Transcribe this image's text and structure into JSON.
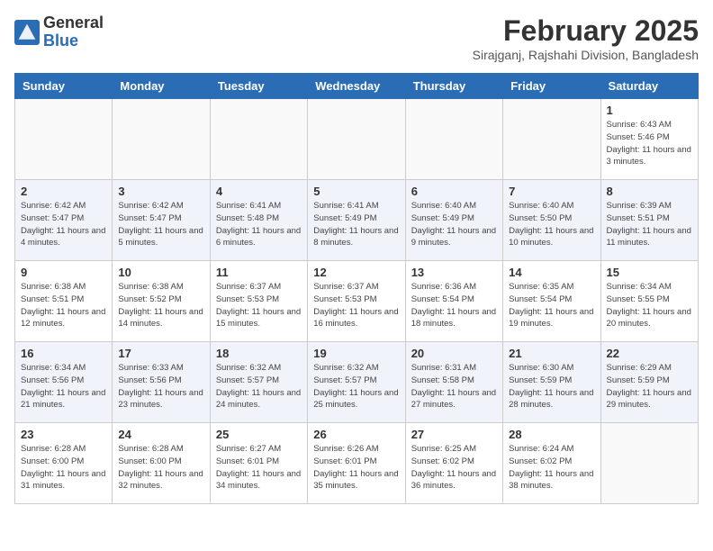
{
  "header": {
    "logo_general": "General",
    "logo_blue": "Blue",
    "month_year": "February 2025",
    "location": "Sirajganj, Rajshahi Division, Bangladesh"
  },
  "days_of_week": [
    "Sunday",
    "Monday",
    "Tuesday",
    "Wednesday",
    "Thursday",
    "Friday",
    "Saturday"
  ],
  "weeks": [
    [
      {
        "day": "",
        "info": ""
      },
      {
        "day": "",
        "info": ""
      },
      {
        "day": "",
        "info": ""
      },
      {
        "day": "",
        "info": ""
      },
      {
        "day": "",
        "info": ""
      },
      {
        "day": "",
        "info": ""
      },
      {
        "day": "1",
        "info": "Sunrise: 6:43 AM\nSunset: 5:46 PM\nDaylight: 11 hours and 3 minutes."
      }
    ],
    [
      {
        "day": "2",
        "info": "Sunrise: 6:42 AM\nSunset: 5:47 PM\nDaylight: 11 hours and 4 minutes."
      },
      {
        "day": "3",
        "info": "Sunrise: 6:42 AM\nSunset: 5:47 PM\nDaylight: 11 hours and 5 minutes."
      },
      {
        "day": "4",
        "info": "Sunrise: 6:41 AM\nSunset: 5:48 PM\nDaylight: 11 hours and 6 minutes."
      },
      {
        "day": "5",
        "info": "Sunrise: 6:41 AM\nSunset: 5:49 PM\nDaylight: 11 hours and 8 minutes."
      },
      {
        "day": "6",
        "info": "Sunrise: 6:40 AM\nSunset: 5:49 PM\nDaylight: 11 hours and 9 minutes."
      },
      {
        "day": "7",
        "info": "Sunrise: 6:40 AM\nSunset: 5:50 PM\nDaylight: 11 hours and 10 minutes."
      },
      {
        "day": "8",
        "info": "Sunrise: 6:39 AM\nSunset: 5:51 PM\nDaylight: 11 hours and 11 minutes."
      }
    ],
    [
      {
        "day": "9",
        "info": "Sunrise: 6:38 AM\nSunset: 5:51 PM\nDaylight: 11 hours and 12 minutes."
      },
      {
        "day": "10",
        "info": "Sunrise: 6:38 AM\nSunset: 5:52 PM\nDaylight: 11 hours and 14 minutes."
      },
      {
        "day": "11",
        "info": "Sunrise: 6:37 AM\nSunset: 5:53 PM\nDaylight: 11 hours and 15 minutes."
      },
      {
        "day": "12",
        "info": "Sunrise: 6:37 AM\nSunset: 5:53 PM\nDaylight: 11 hours and 16 minutes."
      },
      {
        "day": "13",
        "info": "Sunrise: 6:36 AM\nSunset: 5:54 PM\nDaylight: 11 hours and 18 minutes."
      },
      {
        "day": "14",
        "info": "Sunrise: 6:35 AM\nSunset: 5:54 PM\nDaylight: 11 hours and 19 minutes."
      },
      {
        "day": "15",
        "info": "Sunrise: 6:34 AM\nSunset: 5:55 PM\nDaylight: 11 hours and 20 minutes."
      }
    ],
    [
      {
        "day": "16",
        "info": "Sunrise: 6:34 AM\nSunset: 5:56 PM\nDaylight: 11 hours and 21 minutes."
      },
      {
        "day": "17",
        "info": "Sunrise: 6:33 AM\nSunset: 5:56 PM\nDaylight: 11 hours and 23 minutes."
      },
      {
        "day": "18",
        "info": "Sunrise: 6:32 AM\nSunset: 5:57 PM\nDaylight: 11 hours and 24 minutes."
      },
      {
        "day": "19",
        "info": "Sunrise: 6:32 AM\nSunset: 5:57 PM\nDaylight: 11 hours and 25 minutes."
      },
      {
        "day": "20",
        "info": "Sunrise: 6:31 AM\nSunset: 5:58 PM\nDaylight: 11 hours and 27 minutes."
      },
      {
        "day": "21",
        "info": "Sunrise: 6:30 AM\nSunset: 5:59 PM\nDaylight: 11 hours and 28 minutes."
      },
      {
        "day": "22",
        "info": "Sunrise: 6:29 AM\nSunset: 5:59 PM\nDaylight: 11 hours and 29 minutes."
      }
    ],
    [
      {
        "day": "23",
        "info": "Sunrise: 6:28 AM\nSunset: 6:00 PM\nDaylight: 11 hours and 31 minutes."
      },
      {
        "day": "24",
        "info": "Sunrise: 6:28 AM\nSunset: 6:00 PM\nDaylight: 11 hours and 32 minutes."
      },
      {
        "day": "25",
        "info": "Sunrise: 6:27 AM\nSunset: 6:01 PM\nDaylight: 11 hours and 34 minutes."
      },
      {
        "day": "26",
        "info": "Sunrise: 6:26 AM\nSunset: 6:01 PM\nDaylight: 11 hours and 35 minutes."
      },
      {
        "day": "27",
        "info": "Sunrise: 6:25 AM\nSunset: 6:02 PM\nDaylight: 11 hours and 36 minutes."
      },
      {
        "day": "28",
        "info": "Sunrise: 6:24 AM\nSunset: 6:02 PM\nDaylight: 11 hours and 38 minutes."
      },
      {
        "day": "",
        "info": ""
      }
    ]
  ]
}
